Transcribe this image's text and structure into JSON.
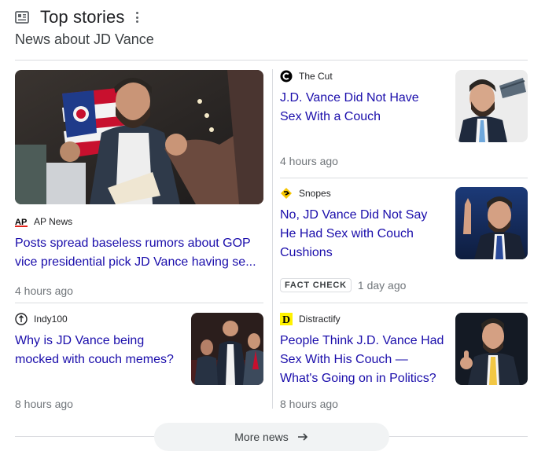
{
  "header": {
    "title": "Top stories",
    "subtitle": "News about JD Vance"
  },
  "featured": {
    "source": "AP News",
    "source_logo_text": "AP",
    "headline": "Posts spread baseless rumors about GOP vice presidential pick JD Vance having se...",
    "time": "4 hours ago"
  },
  "stories": [
    {
      "source": "The Cut",
      "source_icon": "circle-c-logo-icon",
      "headline": "J.D. Vance Did Not Have Sex With a Couch",
      "time": "4 hours ago"
    },
    {
      "source": "Snopes",
      "source_icon": "snopes-logo-icon",
      "headline": "No, JD Vance Did Not Say He Had Sex with Couch Cushions",
      "badge": "FACT CHECK",
      "time": "1 day ago"
    },
    {
      "source": "Indy100",
      "source_icon": "indy100-logo-icon",
      "headline": "Why is JD Vance being mocked with couch memes?",
      "time": "8 hours ago"
    },
    {
      "source": "Distractify",
      "source_icon": "distractify-logo-icon",
      "source_logo_text": "D",
      "headline": "People Think J.D. Vance Had Sex With His Couch — What's Going on in Politics?",
      "time": "8 hours ago"
    }
  ],
  "more_news": {
    "label": "More news"
  },
  "colors": {
    "link": "#1a0dab",
    "meta": "#70757a",
    "divider": "#dadce0",
    "ap_red": "#e2231a",
    "snopes_yellow": "#f7c600",
    "distractify_yellow": "#fff200"
  }
}
